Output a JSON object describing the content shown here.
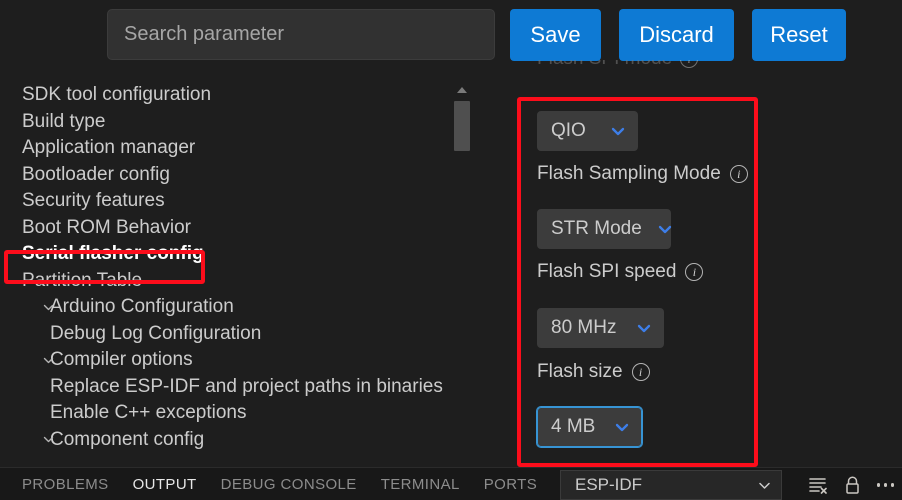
{
  "toolbar": {
    "search_placeholder": "Search parameter",
    "search_value": "",
    "save_label": "Save",
    "discard_label": "Discard",
    "reset_label": "Reset",
    "button_color": "#0e7ad4"
  },
  "sidebar": {
    "items": [
      {
        "label": "SDK tool configuration",
        "indent": 0,
        "chevron": false
      },
      {
        "label": "Build type",
        "indent": 0,
        "chevron": false
      },
      {
        "label": "Application manager",
        "indent": 0,
        "chevron": false
      },
      {
        "label": "Bootloader config",
        "indent": 0,
        "chevron": false
      },
      {
        "label": "Security features",
        "indent": 0,
        "chevron": false
      },
      {
        "label": "Boot ROM Behavior",
        "indent": 0,
        "chevron": false
      },
      {
        "label": "Serial flasher config",
        "indent": 0,
        "chevron": false,
        "selected": true
      },
      {
        "label": "Partition Table",
        "indent": 0,
        "chevron": false
      },
      {
        "label": "Arduino Configuration",
        "indent": 1,
        "chevron": true
      },
      {
        "label": "Debug Log Configuration",
        "indent": 1,
        "chevron": false
      },
      {
        "label": "Compiler options",
        "indent": 1,
        "chevron": true
      },
      {
        "label": "Replace ESP-IDF and project paths in binaries",
        "indent": 1,
        "chevron": false
      },
      {
        "label": "Enable C++ exceptions",
        "indent": 1,
        "chevron": false
      },
      {
        "label": "Component config",
        "indent": 1,
        "chevron": true
      }
    ]
  },
  "panel": {
    "clipped_label": "Flash SPI mode",
    "flash_spi_mode": {
      "value": "QIO"
    },
    "sampling_mode": {
      "label": "Flash Sampling Mode",
      "value": "STR Mode"
    },
    "spi_speed": {
      "label": "Flash SPI speed",
      "value": "80 MHz"
    },
    "flash_size": {
      "label": "Flash size",
      "value": "4 MB",
      "focused": true
    }
  },
  "highlights": {
    "color": "#fc0d1b",
    "sidebar_target": "Serial flasher config",
    "panel_target": "Serial flasher config settings"
  },
  "bottom": {
    "tabs": [
      {
        "label": "PROBLEMS",
        "active": false
      },
      {
        "label": "OUTPUT",
        "active": true
      },
      {
        "label": "DEBUG CONSOLE",
        "active": false
      },
      {
        "label": "TERMINAL",
        "active": false
      },
      {
        "label": "PORTS",
        "active": false
      }
    ],
    "channel_select": "ESP-IDF",
    "icons": [
      "clear-output-icon",
      "lock-icon",
      "more-actions-icon"
    ]
  }
}
